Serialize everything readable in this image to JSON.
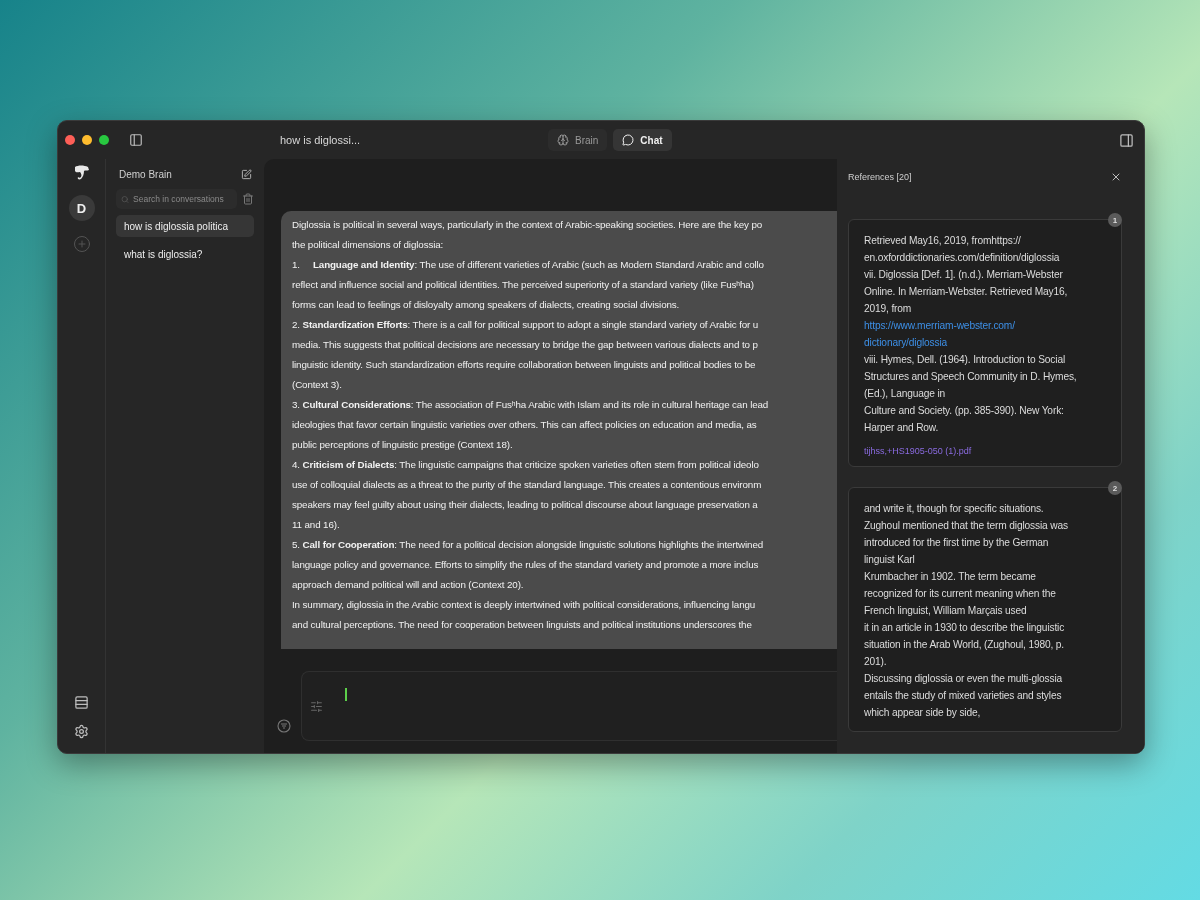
{
  "window": {
    "title": "how is diglossi..."
  },
  "tabs": [
    {
      "label": "Brain",
      "kind": "brain",
      "selected": false
    },
    {
      "label": "Chat",
      "kind": "chat",
      "selected": true
    }
  ],
  "rail": {
    "avatar": "D"
  },
  "sidebar": {
    "brain_name": "Demo Brain",
    "search": {
      "placeholder": "Search in conversations"
    },
    "conversations": [
      {
        "title": "how is diglossia politica",
        "selected": true
      },
      {
        "title": "what is diglossia?",
        "selected": false
      }
    ]
  },
  "message": {
    "lines": [
      "Diglossia is political in several ways, particularly in the context of Arabic-speaking societies. Here are the key po",
      "the political dimensions of diglossia:",
      "1.     **Language and Identity**: The use of different varieties of Arabic (such as Modern Standard Arabic and collo",
      "reflect and influence social and political identities. The perceived superiority of a standard variety (like Fusʰha)",
      "forms can lead to feelings of disloyalty among speakers of dialects, creating social divisions.",
      "2. **Standardization Efforts**: There is a call for political support to adopt a single standard variety of Arabic for u",
      "media. This suggests that political decisions are necessary to bridge the gap between various dialects and to p",
      "linguistic identity. Such standardization efforts require collaboration between linguists and political bodies to be",
      "(Context 3).",
      "3. **Cultural Considerations**: The association of Fusʰha Arabic with Islam and its role in cultural heritage can lead",
      "ideologies that favor certain linguistic varieties over others. This can affect policies on education and media, as",
      "public perceptions of linguistic prestige (Context 18).",
      "4. **Criticism of Dialects**: The linguistic campaigns that criticize spoken varieties often stem from political ideolo",
      "use of colloquial dialects as a threat to the purity of the standard language. This creates a contentious environm",
      "speakers may feel guilty about using their dialects, leading to political discourse about language preservation a",
      "11 and 16).",
      "5. **Call for Cooperation**: The need for a political decision alongside linguistic solutions highlights the intertwined",
      "language policy and governance. Efforts to simplify the rules of the standard variety and promote a more inclus",
      "approach demand political will and action (Context 20).",
      "In summary, diglossia in the Arabic context is deeply intertwined with political considerations, influencing langu",
      "and cultural perceptions. The need for cooperation between linguists and political institutions underscores the"
    ]
  },
  "composer": {
    "focused": true
  },
  "references": {
    "title": "References [20]",
    "cards": [
      {
        "badge": "1",
        "source": "tijhss,+HS1905-050 (1).pdf",
        "parts": [
          {
            "kind": "text",
            "text": "Retrieved May16, 2019, fromhttps://\nen.oxforddictionaries.com/definition/diglossia\nvii. Diglossia [Def. 1]. (n.d.). Merriam-Webster\nOnline. In Merriam-Webster. Retrieved May16,\n2019, from"
          },
          {
            "kind": "link",
            "text": "https://www.merriam-webster.com/\ndictionary/diglossia"
          },
          {
            "kind": "text",
            "text": "viii. Hymes, Dell. (1964). Introduction to Social\nStructures and Speech Community in D. Hymes,\n(Ed.), Language in\nCulture and Society. (pp. 385-390). New York:\nHarper and Row."
          }
        ]
      },
      {
        "badge": "2",
        "parts": [
          {
            "kind": "text",
            "text": "and write it, though for specific situations.\nZughoul mentioned that the term diglossia was\nintroduced for the first time by the German\nlinguist Karl\nKrumbacher in 1902. The term became\nrecognized for its current meaning when the\nFrench linguist, William Marçais used\nit in an article in 1930 to describe the linguistic\nsituation in the Arab World, (Zughoul, 1980, p.\n201).\nDiscussing diglossia or even the multi-glossia\nentails the study of mixed varieties and styles\nwhich appear side by side,"
          }
        ]
      }
    ]
  }
}
